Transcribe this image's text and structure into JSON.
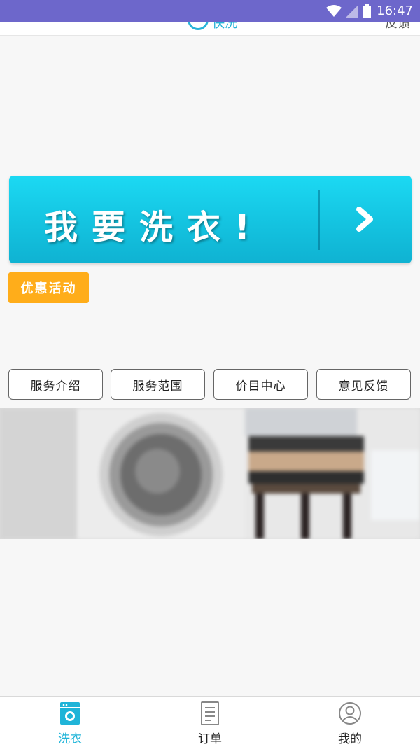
{
  "status_bar": {
    "time": "16:47",
    "background": "#6d67cb"
  },
  "header": {
    "title": "快洗",
    "right_text": "反馈"
  },
  "cta": {
    "label": "我要洗衣!",
    "icon": "chevron-right-icon",
    "color": "#14c3e0"
  },
  "promo": {
    "label": "优惠活动",
    "color": "#ffad1a"
  },
  "services": [
    {
      "label": "服务介绍"
    },
    {
      "label": "服务范围"
    },
    {
      "label": "价目中心"
    },
    {
      "label": "意见反馈"
    }
  ],
  "bottom_nav": {
    "items": [
      {
        "label": "洗衣",
        "icon": "washing-machine-icon",
        "active": true
      },
      {
        "label": "订单",
        "icon": "document-icon",
        "active": false
      },
      {
        "label": "我的",
        "icon": "user-icon",
        "active": false
      }
    ],
    "active_color": "#1fb4d8"
  }
}
